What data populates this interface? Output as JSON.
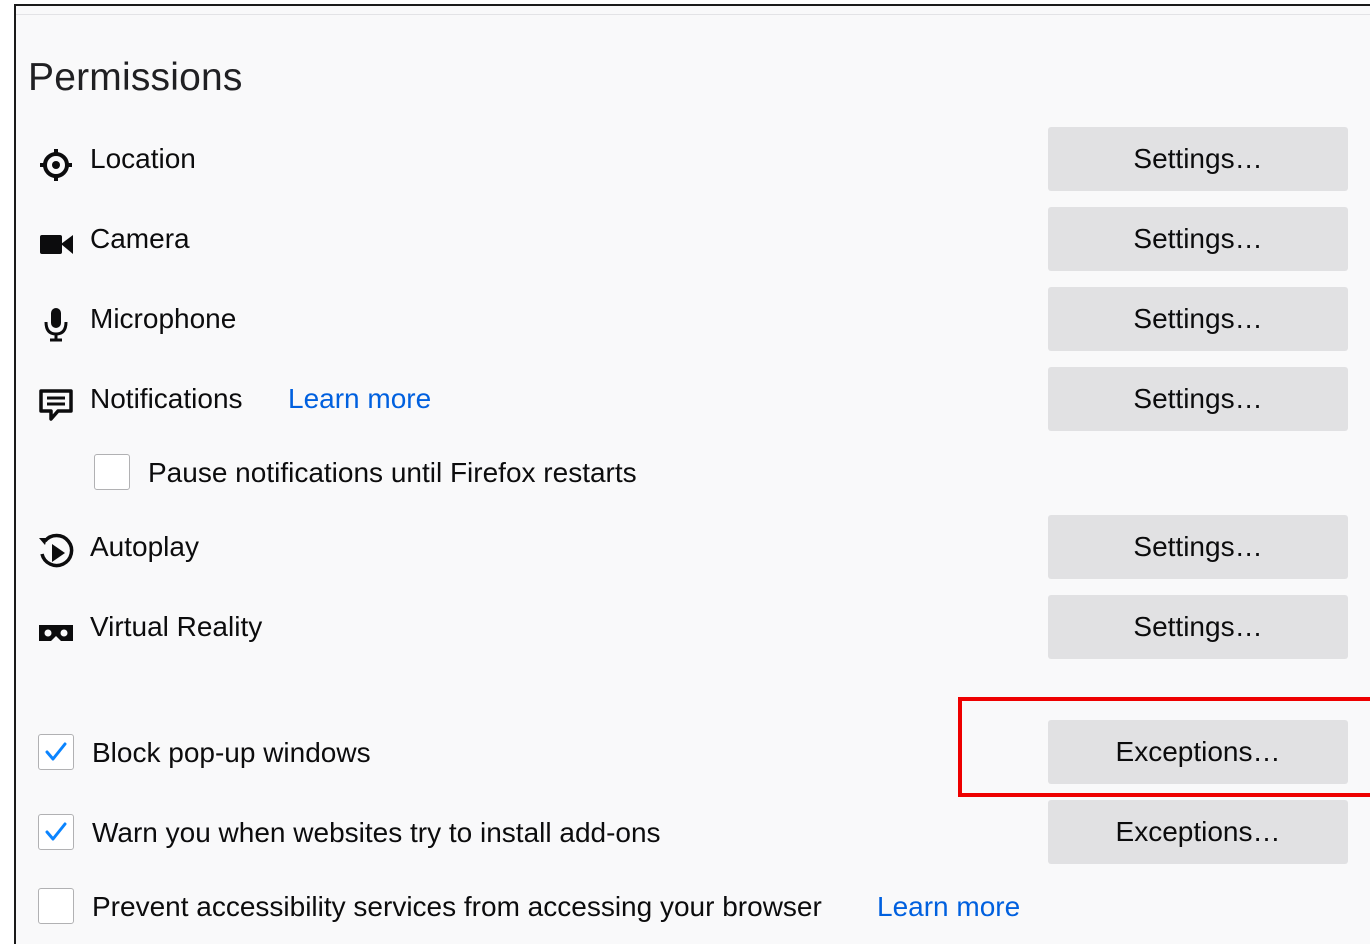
{
  "section": {
    "title": "Permissions"
  },
  "permissions": [
    {
      "label": "Location",
      "icon": "location-icon",
      "button": "Settings…"
    },
    {
      "label": "Camera",
      "icon": "camera-icon",
      "button": "Settings…"
    },
    {
      "label": "Microphone",
      "icon": "microphone-icon",
      "button": "Settings…"
    },
    {
      "label": "Notifications",
      "icon": "notifications-icon",
      "button": "Settings…",
      "learn_more": "Learn more"
    },
    {
      "label": "Autoplay",
      "icon": "autoplay-icon",
      "button": "Settings…"
    },
    {
      "label": "Virtual Reality",
      "icon": "virtual-reality-icon",
      "button": "Settings…"
    }
  ],
  "pause_notifications": {
    "label": "Pause notifications until Firefox restarts",
    "checked": false
  },
  "block_popups": {
    "label": "Block pop-up windows",
    "checked": true,
    "button": "Exceptions…"
  },
  "warn_addons": {
    "label": "Warn you when websites try to install add-ons",
    "checked": true,
    "button": "Exceptions…"
  },
  "prevent_accessibility": {
    "label": "Prevent accessibility services from accessing your browser",
    "checked": false,
    "learn_more": "Learn more"
  },
  "colors": {
    "link": "#0060df",
    "checkmark": "#0a84ff",
    "button_bg": "#e1e1e3",
    "highlight": "#ee0000"
  }
}
